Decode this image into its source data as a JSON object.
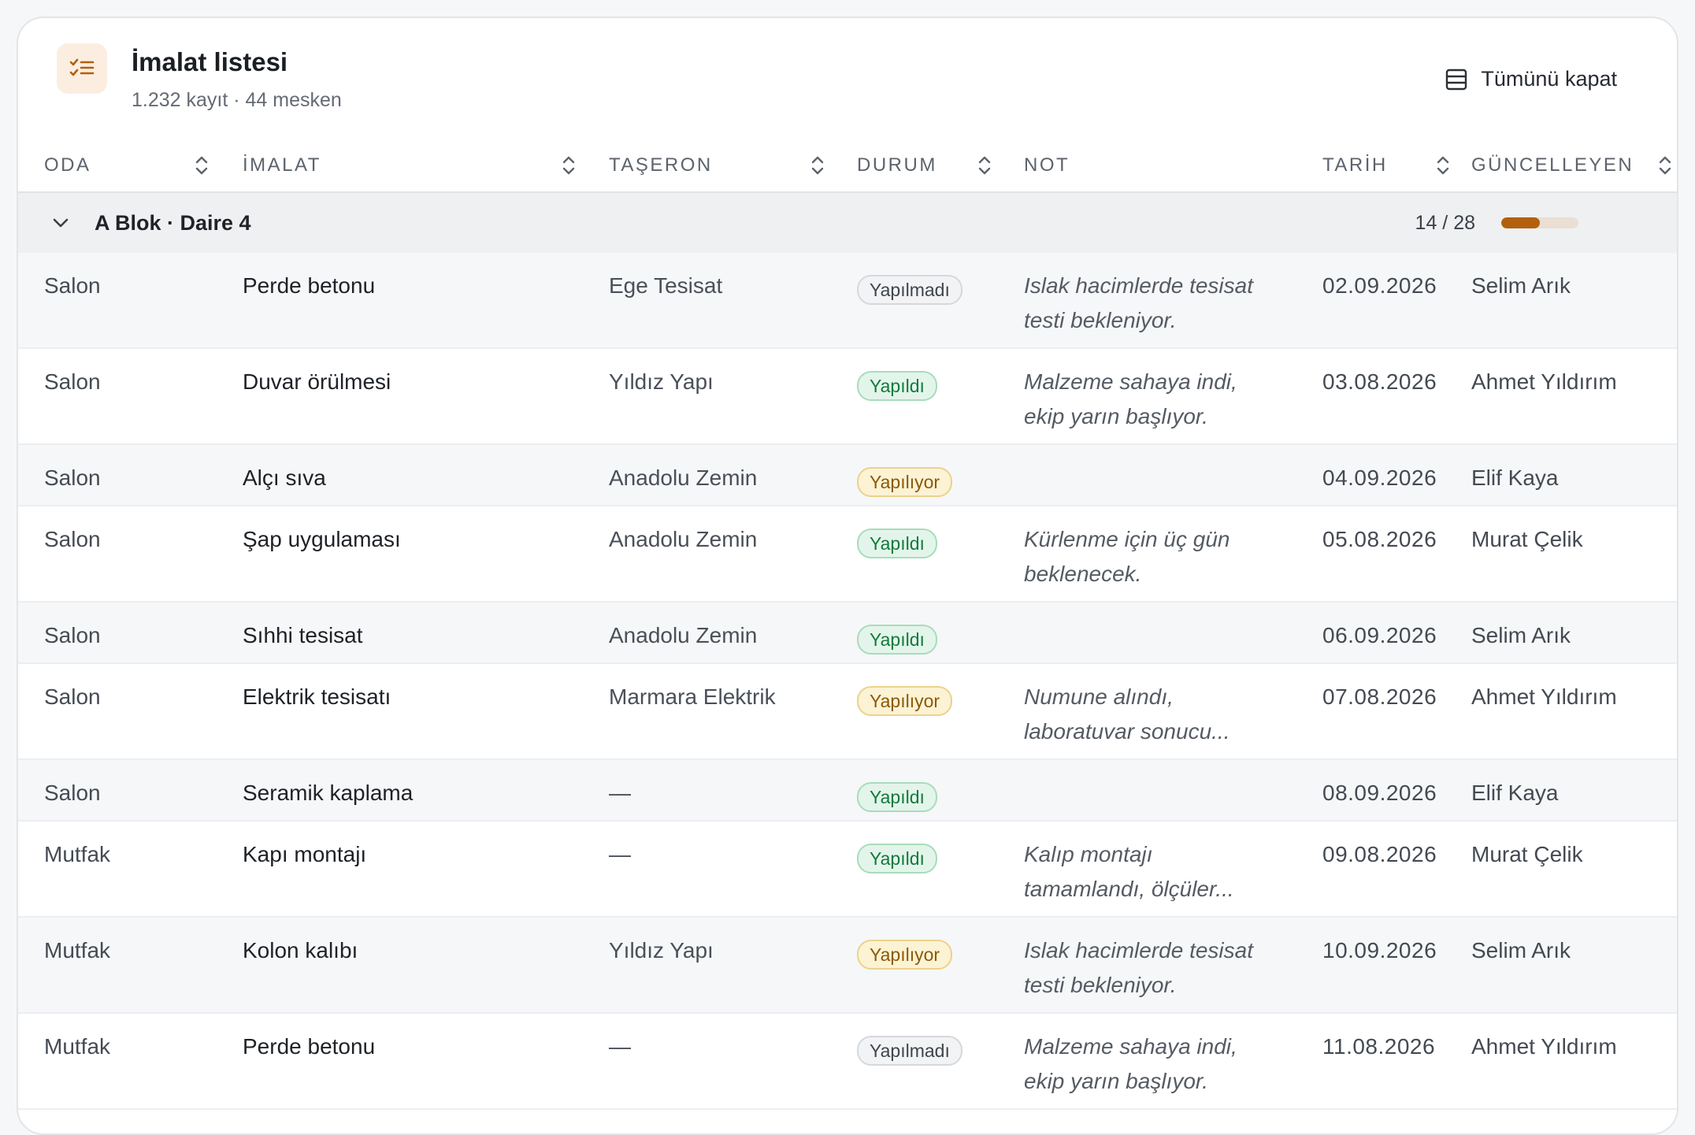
{
  "header": {
    "title": "İmalat listesi",
    "subtitle": "1.232 kayıt · 44 mesken",
    "collapse_all_label": "Tümünü kapat",
    "icon": "checklist-icon"
  },
  "columns": [
    {
      "key": "oda",
      "label": "ODA",
      "sortable": true
    },
    {
      "key": "imalat",
      "label": "İMALAT",
      "sortable": true
    },
    {
      "key": "taseron",
      "label": "TAŞERON",
      "sortable": true
    },
    {
      "key": "durum",
      "label": "DURUM",
      "sortable": true
    },
    {
      "key": "not",
      "label": "NOT",
      "sortable": false
    },
    {
      "key": "tarih",
      "label": "TARİH",
      "sortable": true
    },
    {
      "key": "guncelleyen",
      "label": "GÜNCELLEYEN",
      "sortable": true
    }
  ],
  "group": {
    "title": "A Blok · Daire 4",
    "count_label": "14 / 28",
    "progress": 0.5,
    "expanded": true
  },
  "colors": {
    "accent": "#b3600d",
    "status_done": "#137a3c",
    "status_in_progress": "#8a5a06",
    "status_todo": "#3f454d"
  },
  "rows": [
    {
      "oda": "Salon",
      "imalat": "Perde betonu",
      "taseron": "Ege Tesisat",
      "durum": "Yapılmadı",
      "durum_kind": "todo",
      "not1": "Islak hacimlerde tesisat",
      "not2": "testi bekleniyor.",
      "tarih": "02.09.2026",
      "guncelleyen": "Selim Arık"
    },
    {
      "oda": "Salon",
      "imalat": "Duvar örülmesi",
      "taseron": "Yıldız Yapı",
      "durum": "Yapıldı",
      "durum_kind": "done",
      "not1": "Malzeme sahaya indi,",
      "not2": "ekip yarın başlıyor.",
      "tarih": "03.08.2026",
      "guncelleyen": "Ahmet Yıldırım"
    },
    {
      "oda": "Salon",
      "imalat": "Alçı sıva",
      "taseron": "Anadolu Zemin",
      "durum": "Yapılıyor",
      "durum_kind": "in_progress",
      "not1": "",
      "not2": "",
      "tarih": "04.09.2026",
      "guncelleyen": "Elif Kaya"
    },
    {
      "oda": "Salon",
      "imalat": "Şap uygulaması",
      "taseron": "Anadolu Zemin",
      "durum": "Yapıldı",
      "durum_kind": "done",
      "not1": "Kürlenme için üç gün",
      "not2": "beklenecek.",
      "tarih": "05.08.2026",
      "guncelleyen": "Murat Çelik"
    },
    {
      "oda": "Salon",
      "imalat": "Sıhhi tesisat",
      "taseron": "Anadolu Zemin",
      "durum": "Yapıldı",
      "durum_kind": "done",
      "not1": "",
      "not2": "",
      "tarih": "06.09.2026",
      "guncelleyen": "Selim Arık"
    },
    {
      "oda": "Salon",
      "imalat": "Elektrik tesisatı",
      "taseron": "Marmara Elektrik",
      "durum": "Yapılıyor",
      "durum_kind": "in_progress",
      "not1": "Numune alındı,",
      "not2": "laboratuvar sonucu...",
      "tarih": "07.08.2026",
      "guncelleyen": "Ahmet Yıldırım"
    },
    {
      "oda": "Salon",
      "imalat": "Seramik kaplama",
      "taseron": "—",
      "durum": "Yapıldı",
      "durum_kind": "done",
      "not1": "",
      "not2": "",
      "tarih": "08.09.2026",
      "guncelleyen": "Elif Kaya"
    },
    {
      "oda": "Mutfak",
      "imalat": "Kapı montajı",
      "taseron": "—",
      "durum": "Yapıldı",
      "durum_kind": "done",
      "not1": "Kalıp montajı",
      "not2": "tamamlandı, ölçüler...",
      "tarih": "09.08.2026",
      "guncelleyen": "Murat Çelik"
    },
    {
      "oda": "Mutfak",
      "imalat": "Kolon kalıbı",
      "taseron": "Yıldız Yapı",
      "durum": "Yapılıyor",
      "durum_kind": "in_progress",
      "not1": "Islak hacimlerde tesisat",
      "not2": "testi bekleniyor.",
      "tarih": "10.09.2026",
      "guncelleyen": "Selim Arık"
    },
    {
      "oda": "Mutfak",
      "imalat": "Perde betonu",
      "taseron": "—",
      "durum": "Yapılmadı",
      "durum_kind": "todo",
      "not1": "Malzeme sahaya indi,",
      "not2": "ekip yarın başlıyor.",
      "tarih": "11.08.2026",
      "guncelleyen": "Ahmet Yıldırım"
    }
  ]
}
